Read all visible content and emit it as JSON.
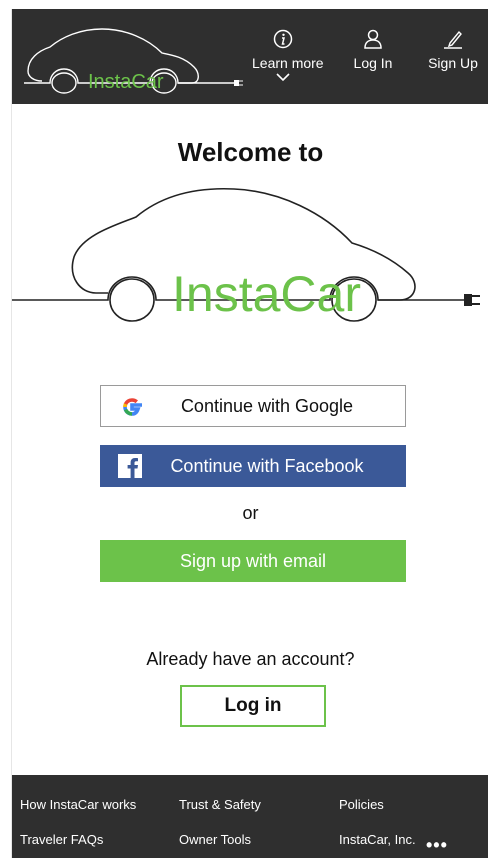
{
  "header": {
    "logo_text": "InstaCar",
    "nav": [
      {
        "label": "Learn more",
        "icon": "info-icon"
      },
      {
        "label": "Log In",
        "icon": "user-icon"
      },
      {
        "label": "Sign Up",
        "icon": "pencil-icon"
      }
    ]
  },
  "main": {
    "welcome": "Welcome to",
    "logo_text": "InstaCar",
    "google_label": "Continue with Google",
    "facebook_label": "Continue with Facebook",
    "or_label": "or",
    "email_label": "Sign up with email",
    "already_label": "Already have an account?",
    "login_label": "Log in"
  },
  "footer": {
    "links": [
      "How InstaCar works",
      "Trust & Safety",
      "Policies",
      "Traveler FAQs",
      "Owner Tools",
      "InstaCar, Inc."
    ],
    "more": "•••"
  },
  "colors": {
    "header_bg": "#2f2f2f",
    "brand_green": "#6cc24a",
    "facebook_blue": "#3b5998"
  }
}
